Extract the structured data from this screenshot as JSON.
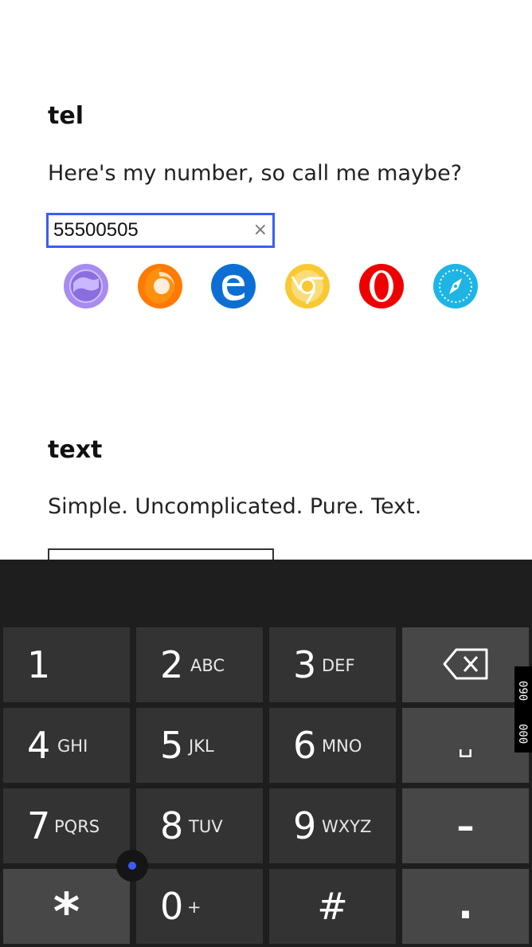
{
  "tel_section": {
    "title": "tel",
    "description": "Here's my number, so call me maybe?",
    "input_value": "55500505",
    "clear_glyph": "×"
  },
  "browsers": [
    {
      "name": "samsung-internet",
      "color": "#a78bf0"
    },
    {
      "name": "firefox",
      "color": "#ff7a00"
    },
    {
      "name": "edge",
      "color": "#0d6fd4"
    },
    {
      "name": "chrome",
      "color": "#f9c934"
    },
    {
      "name": "opera",
      "color": "#ee0000"
    },
    {
      "name": "safari",
      "color": "#1eb5e5"
    }
  ],
  "text_section": {
    "title": "text",
    "description": "Simple. Uncomplicated. Pure. Text."
  },
  "keyboard": {
    "keys": [
      {
        "digit": "1",
        "letters": ""
      },
      {
        "digit": "2",
        "letters": "ABC"
      },
      {
        "digit": "3",
        "letters": "DEF"
      },
      {
        "digit": "4",
        "letters": "GHI"
      },
      {
        "digit": "5",
        "letters": "JKL"
      },
      {
        "digit": "6",
        "letters": "MNO"
      },
      {
        "digit": "7",
        "letters": "PQRS"
      },
      {
        "digit": "8",
        "letters": "TUV"
      },
      {
        "digit": "9",
        "letters": "WXYZ"
      },
      {
        "digit": "*",
        "letters": ""
      },
      {
        "digit": "0",
        "letters": "+"
      },
      {
        "digit": "#",
        "letters": ""
      }
    ],
    "space_glyph": "␣",
    "dash_glyph": "–",
    "dot_glyph": "."
  },
  "overlay_tag": {
    "line1": "090",
    "line2": "000"
  },
  "colors": {
    "focus_border": "#3b5bff",
    "keyboard_bg": "#1e1e1e",
    "key_bg": "#333333",
    "func_key_bg": "#474747"
  }
}
